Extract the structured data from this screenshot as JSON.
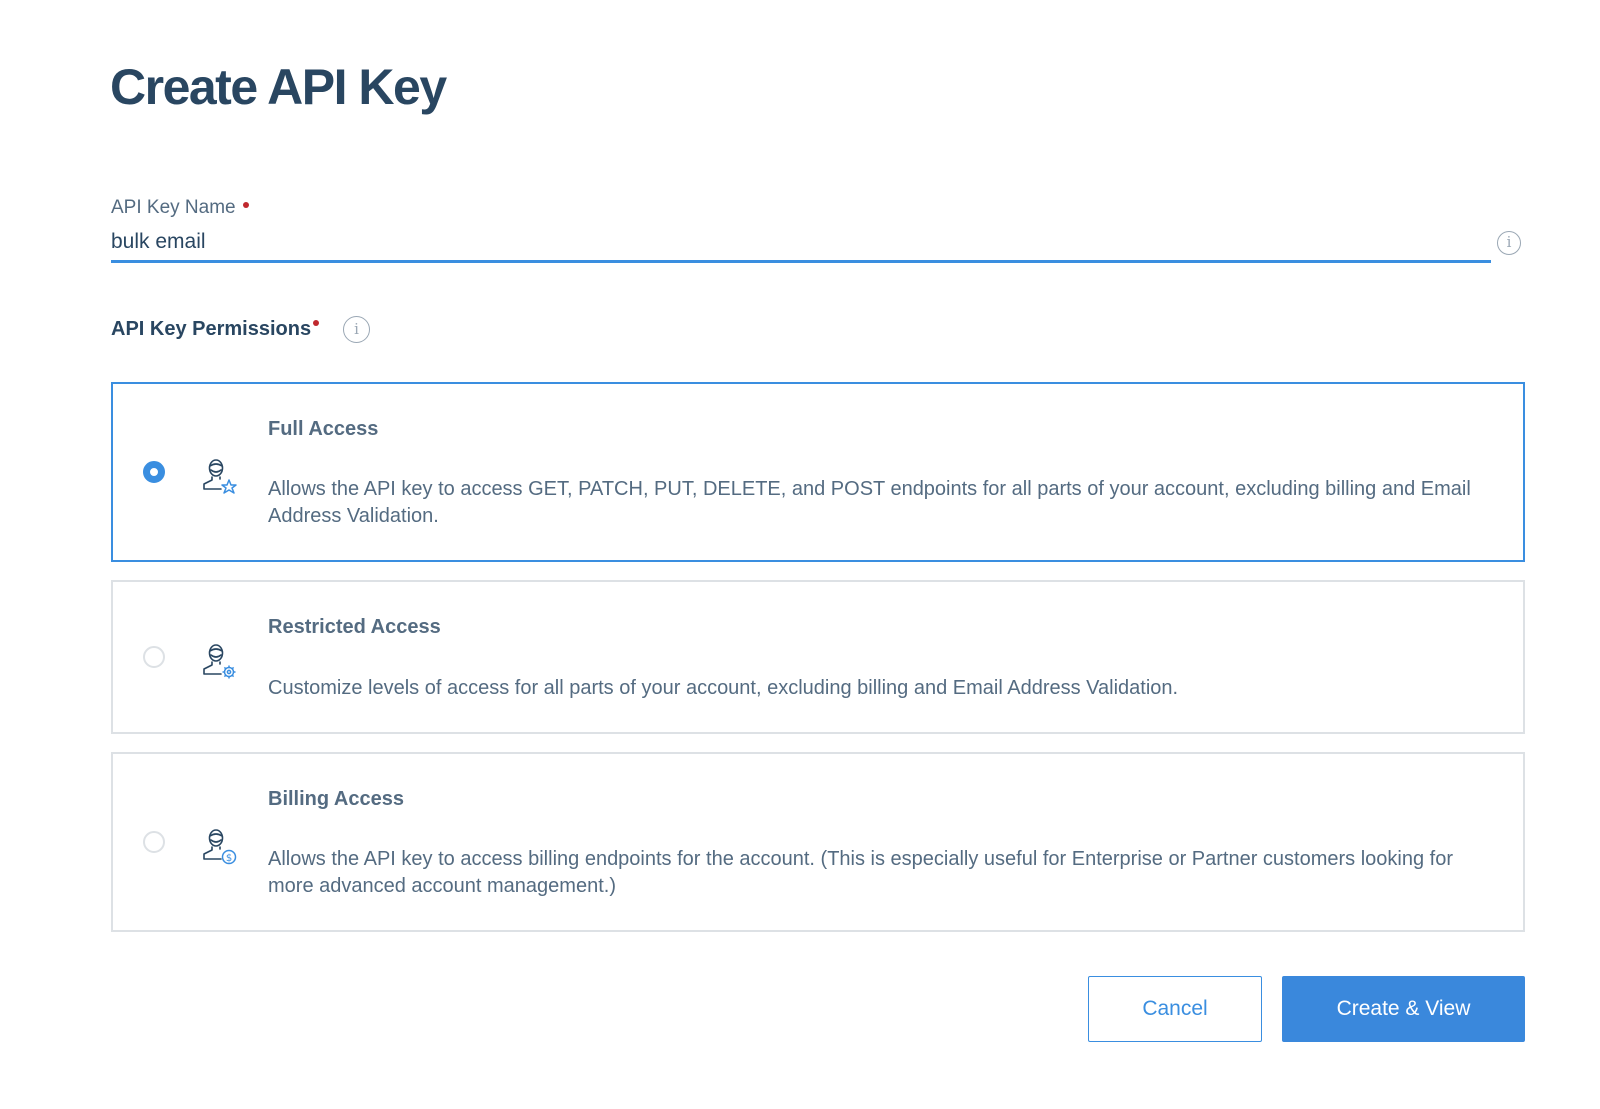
{
  "page": {
    "title": "Create API Key"
  },
  "name_field": {
    "label": "API Key Name",
    "required": true,
    "value": "bulk email",
    "info_icon": "info-icon"
  },
  "permissions": {
    "label": "API Key Permissions",
    "required": true,
    "info_icon": "info-icon",
    "options": [
      {
        "title": "Full Access",
        "description": "Allows the API key to access GET, PATCH, PUT, DELETE, and POST endpoints for all parts of your account, excluding billing and Email Address Validation.",
        "icon": "user-star-icon",
        "selected": true
      },
      {
        "title": "Restricted Access",
        "description": "Customize levels of access for all parts of your account, excluding billing and Email Address Validation.",
        "icon": "user-gear-icon",
        "selected": false
      },
      {
        "title": "Billing Access",
        "description": "Allows the API key to access billing endpoints for the account. (This is especially useful for Enterprise or Partner customers looking for more advanced account management.)",
        "icon": "user-dollar-icon",
        "selected": false
      }
    ]
  },
  "actions": {
    "cancel_label": "Cancel",
    "create_label": "Create & View"
  },
  "colors": {
    "accent": "#3a8ee0",
    "heading": "#294661",
    "body_text": "#546b81",
    "required": "#c0282e",
    "border": "#dde1e5"
  }
}
